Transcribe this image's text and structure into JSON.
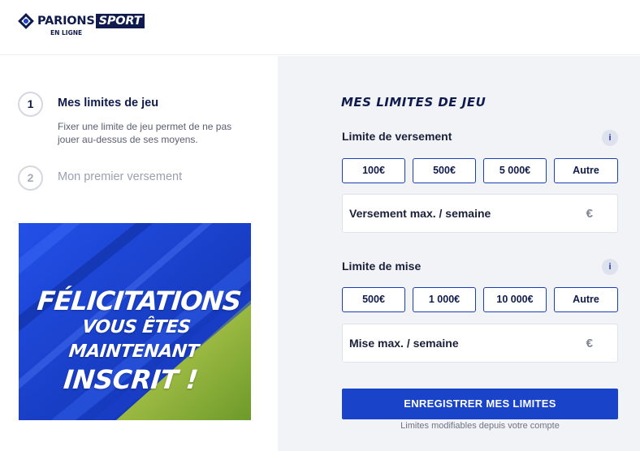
{
  "header": {
    "logo": {
      "word": "PARIONS",
      "word_highlight": "SPORT",
      "sub": "EN LIGNE"
    }
  },
  "steps": [
    {
      "number": "1",
      "title": "Mes limites de jeu",
      "description": "Fixer une limite de jeu permet de ne pas jouer au-dessus de ses moyens."
    },
    {
      "number": "2",
      "title": "Mon premier versement"
    }
  ],
  "banner": {
    "line1": "FÉLICITATIONS",
    "line2": "VOUS ÊTES MAINTENANT",
    "line3": "INSCRIT !"
  },
  "limits": {
    "title": "MES LIMITES DE JEU",
    "deposit": {
      "label": "Limite de versement",
      "info_icon": "i",
      "options": [
        "100€",
        "500€",
        "5 000€",
        "Autre"
      ],
      "input_placeholder": "Versement max. / semaine",
      "currency": "€"
    },
    "bet": {
      "label": "Limite de mise",
      "info_icon": "i",
      "options": [
        "500€",
        "1 000€",
        "10 000€",
        "Autre"
      ],
      "input_placeholder": "Mise max. / semaine",
      "currency": "€"
    },
    "submit_label": "ENREGISTRER MES LIMITES",
    "note": "Limites modifiables depuis votre compte"
  },
  "colors": {
    "brand_navy": "#0f1b4d",
    "primary_blue": "#1943c8",
    "panel_bg": "#f2f3f6"
  }
}
